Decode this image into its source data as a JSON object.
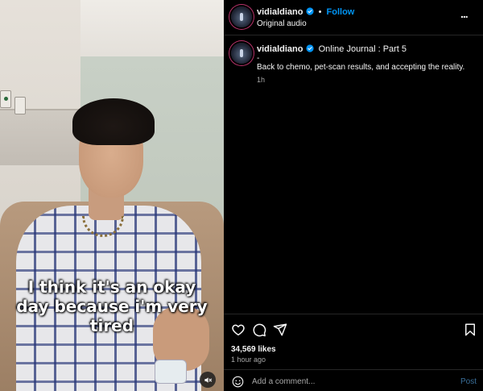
{
  "video": {
    "caption": "I think it's an okay day because i'm very tired",
    "mute_icon": "speaker-muted-icon"
  },
  "header": {
    "username": "vidialdiano",
    "separator": "•",
    "follow_label": "Follow",
    "audio": "Original audio",
    "more_icon": "more-options-icon",
    "more_label": "..."
  },
  "post": {
    "username": "vidialdiano",
    "title": "Online Journal : Part 5",
    "dash": "-",
    "body": "Back to chemo, pet-scan results, and accepting the reality.",
    "time": "1h"
  },
  "actions": {
    "likes": "34,569 likes",
    "ago": "1 hour ago"
  },
  "comment": {
    "placeholder": "Add a comment...",
    "post_label": "Post"
  },
  "colors": {
    "accent": "#0095f6",
    "background": "#000000",
    "muted_text": "#a8a8a8"
  }
}
